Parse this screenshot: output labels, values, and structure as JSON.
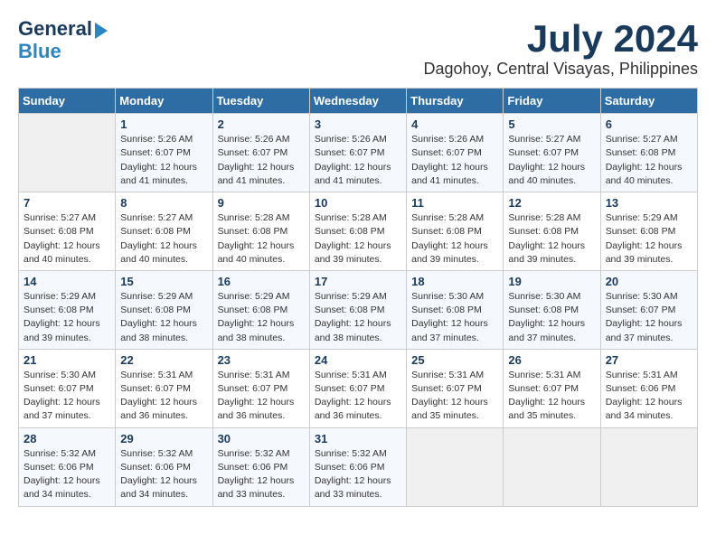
{
  "header": {
    "logo_line1": "General",
    "logo_line2": "Blue",
    "month_year": "July 2024",
    "location": "Dagohoy, Central Visayas, Philippines"
  },
  "weekdays": [
    "Sunday",
    "Monday",
    "Tuesday",
    "Wednesday",
    "Thursday",
    "Friday",
    "Saturday"
  ],
  "weeks": [
    [
      {
        "day": "",
        "info": ""
      },
      {
        "day": "1",
        "info": "Sunrise: 5:26 AM\nSunset: 6:07 PM\nDaylight: 12 hours and 41 minutes."
      },
      {
        "day": "2",
        "info": "Sunrise: 5:26 AM\nSunset: 6:07 PM\nDaylight: 12 hours and 41 minutes."
      },
      {
        "day": "3",
        "info": "Sunrise: 5:26 AM\nSunset: 6:07 PM\nDaylight: 12 hours and 41 minutes."
      },
      {
        "day": "4",
        "info": "Sunrise: 5:26 AM\nSunset: 6:07 PM\nDaylight: 12 hours and 41 minutes."
      },
      {
        "day": "5",
        "info": "Sunrise: 5:27 AM\nSunset: 6:07 PM\nDaylight: 12 hours and 40 minutes."
      },
      {
        "day": "6",
        "info": "Sunrise: 5:27 AM\nSunset: 6:08 PM\nDaylight: 12 hours and 40 minutes."
      }
    ],
    [
      {
        "day": "7",
        "info": "Sunrise: 5:27 AM\nSunset: 6:08 PM\nDaylight: 12 hours and 40 minutes."
      },
      {
        "day": "8",
        "info": "Sunrise: 5:27 AM\nSunset: 6:08 PM\nDaylight: 12 hours and 40 minutes."
      },
      {
        "day": "9",
        "info": "Sunrise: 5:28 AM\nSunset: 6:08 PM\nDaylight: 12 hours and 40 minutes."
      },
      {
        "day": "10",
        "info": "Sunrise: 5:28 AM\nSunset: 6:08 PM\nDaylight: 12 hours and 39 minutes."
      },
      {
        "day": "11",
        "info": "Sunrise: 5:28 AM\nSunset: 6:08 PM\nDaylight: 12 hours and 39 minutes."
      },
      {
        "day": "12",
        "info": "Sunrise: 5:28 AM\nSunset: 6:08 PM\nDaylight: 12 hours and 39 minutes."
      },
      {
        "day": "13",
        "info": "Sunrise: 5:29 AM\nSunset: 6:08 PM\nDaylight: 12 hours and 39 minutes."
      }
    ],
    [
      {
        "day": "14",
        "info": "Sunrise: 5:29 AM\nSunset: 6:08 PM\nDaylight: 12 hours and 39 minutes."
      },
      {
        "day": "15",
        "info": "Sunrise: 5:29 AM\nSunset: 6:08 PM\nDaylight: 12 hours and 38 minutes."
      },
      {
        "day": "16",
        "info": "Sunrise: 5:29 AM\nSunset: 6:08 PM\nDaylight: 12 hours and 38 minutes."
      },
      {
        "day": "17",
        "info": "Sunrise: 5:29 AM\nSunset: 6:08 PM\nDaylight: 12 hours and 38 minutes."
      },
      {
        "day": "18",
        "info": "Sunrise: 5:30 AM\nSunset: 6:08 PM\nDaylight: 12 hours and 37 minutes."
      },
      {
        "day": "19",
        "info": "Sunrise: 5:30 AM\nSunset: 6:08 PM\nDaylight: 12 hours and 37 minutes."
      },
      {
        "day": "20",
        "info": "Sunrise: 5:30 AM\nSunset: 6:07 PM\nDaylight: 12 hours and 37 minutes."
      }
    ],
    [
      {
        "day": "21",
        "info": "Sunrise: 5:30 AM\nSunset: 6:07 PM\nDaylight: 12 hours and 37 minutes."
      },
      {
        "day": "22",
        "info": "Sunrise: 5:31 AM\nSunset: 6:07 PM\nDaylight: 12 hours and 36 minutes."
      },
      {
        "day": "23",
        "info": "Sunrise: 5:31 AM\nSunset: 6:07 PM\nDaylight: 12 hours and 36 minutes."
      },
      {
        "day": "24",
        "info": "Sunrise: 5:31 AM\nSunset: 6:07 PM\nDaylight: 12 hours and 36 minutes."
      },
      {
        "day": "25",
        "info": "Sunrise: 5:31 AM\nSunset: 6:07 PM\nDaylight: 12 hours and 35 minutes."
      },
      {
        "day": "26",
        "info": "Sunrise: 5:31 AM\nSunset: 6:07 PM\nDaylight: 12 hours and 35 minutes."
      },
      {
        "day": "27",
        "info": "Sunrise: 5:31 AM\nSunset: 6:06 PM\nDaylight: 12 hours and 34 minutes."
      }
    ],
    [
      {
        "day": "28",
        "info": "Sunrise: 5:32 AM\nSunset: 6:06 PM\nDaylight: 12 hours and 34 minutes."
      },
      {
        "day": "29",
        "info": "Sunrise: 5:32 AM\nSunset: 6:06 PM\nDaylight: 12 hours and 34 minutes."
      },
      {
        "day": "30",
        "info": "Sunrise: 5:32 AM\nSunset: 6:06 PM\nDaylight: 12 hours and 33 minutes."
      },
      {
        "day": "31",
        "info": "Sunrise: 5:32 AM\nSunset: 6:06 PM\nDaylight: 12 hours and 33 minutes."
      },
      {
        "day": "",
        "info": ""
      },
      {
        "day": "",
        "info": ""
      },
      {
        "day": "",
        "info": ""
      }
    ]
  ]
}
